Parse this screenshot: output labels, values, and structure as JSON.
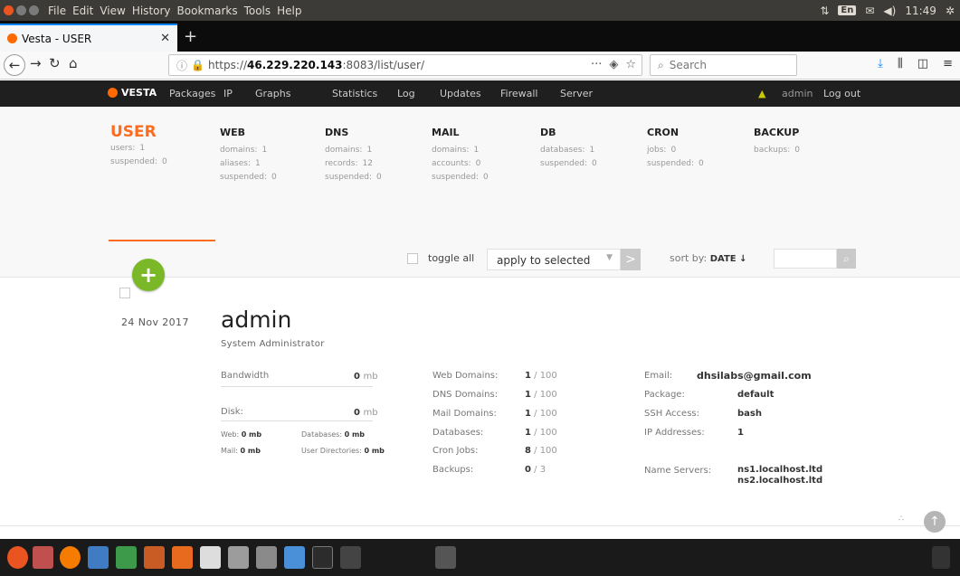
{
  "os_menu": [
    "File",
    "Edit",
    "View",
    "History",
    "Bookmarks",
    "Tools",
    "Help"
  ],
  "os_tray": {
    "lang": "En",
    "time": "11:49"
  },
  "browser": {
    "tab_title": "Vesta - USER",
    "url_prefix": "https://",
    "url_host": "46.229.220.143",
    "url_rest": ":8083/list/user/",
    "search_placeholder": "Search"
  },
  "nav": {
    "logo": "VESTA",
    "items": [
      "Packages",
      "IP",
      "Graphs",
      "Statistics",
      "Log",
      "Updates",
      "Firewall",
      "Server"
    ],
    "user": "admin",
    "logout": "Log out"
  },
  "stats": {
    "user": {
      "title": "USER",
      "rows": [
        [
          "users:",
          "1"
        ],
        [
          "suspended:",
          "0"
        ]
      ]
    },
    "web": {
      "title": "WEB",
      "rows": [
        [
          "domains:",
          "1"
        ],
        [
          "aliases:",
          "1"
        ],
        [
          "suspended:",
          "0"
        ]
      ]
    },
    "dns": {
      "title": "DNS",
      "rows": [
        [
          "domains:",
          "1"
        ],
        [
          "records:",
          "12"
        ],
        [
          "suspended:",
          "0"
        ]
      ]
    },
    "mail": {
      "title": "MAIL",
      "rows": [
        [
          "domains:",
          "1"
        ],
        [
          "accounts:",
          "0"
        ],
        [
          "suspended:",
          "0"
        ]
      ]
    },
    "db": {
      "title": "DB",
      "rows": [
        [
          "databases:",
          "1"
        ],
        [
          "suspended:",
          "0"
        ]
      ]
    },
    "cron": {
      "title": "CRON",
      "rows": [
        [
          "jobs:",
          "0"
        ],
        [
          "suspended:",
          "0"
        ]
      ]
    },
    "backup": {
      "title": "BACKUP",
      "rows": [
        [
          "backups:",
          "0"
        ]
      ]
    }
  },
  "toolbar": {
    "toggle_all": "toggle all",
    "apply": "apply to selected",
    "sort_by": "sort by:",
    "sort_field": "DATE ↓"
  },
  "entry": {
    "date": "24 Nov 2017",
    "username": "admin",
    "role": "System Administrator",
    "bandwidth_label": "Bandwidth",
    "bandwidth_value": "0",
    "disk_label": "Disk:",
    "disk_value": "0",
    "unit": "mb",
    "web_label": "Web:",
    "web_value": "0 mb",
    "mail_label": "Mail:",
    "mail_value": "0 mb",
    "databases_label": "Databases:",
    "databases_value": "0 mb",
    "userdirs_label": "User Directories:",
    "userdirs_value": "0 mb",
    "limits": [
      {
        "label": "Web Domains:",
        "used": "1",
        "max": " / 100"
      },
      {
        "label": "DNS Domains:",
        "used": "1",
        "max": " / 100"
      },
      {
        "label": "Mail Domains:",
        "used": "1",
        "max": " / 100"
      },
      {
        "label": "Databases:",
        "used": "1",
        "max": " / 100"
      },
      {
        "label": "Cron Jobs:",
        "used": "8",
        "max": " / 100"
      },
      {
        "label": "Backups:",
        "used": "0",
        "max": " / 3"
      }
    ],
    "details": [
      {
        "label": "Email:",
        "value": "dhsilabs@gmail.com"
      },
      {
        "label": "Package:",
        "value": "default"
      },
      {
        "label": "SSH Access:",
        "value": "bash"
      },
      {
        "label": "IP Addresses:",
        "value": "1"
      }
    ],
    "ns_label": "Name Servers:",
    "ns": [
      "ns1.localhost.ltd",
      "ns2.localhost.ltd"
    ]
  }
}
